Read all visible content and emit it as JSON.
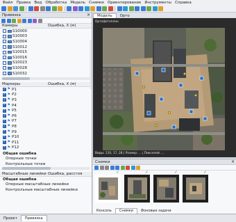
{
  "menubar": {
    "items": [
      "Файл",
      "Правка",
      "Вид",
      "Обработка",
      "Модель",
      "Снимки",
      "Ориентирование",
      "Инструменты",
      "Справка"
    ]
  },
  "toolbar_colors": [
    "#3b7bd4",
    "#e1a02d",
    "#4a90d9",
    "#6aa84f",
    "#3b7bd4",
    "#d34b3b",
    "#888888",
    "#3b7bd4",
    "#6aa84f",
    "#e1a02d",
    "#3b7bd4",
    "#8e5cc7",
    "#3b7bd4",
    "#2d9bd1",
    "#e1a02d",
    "#3b7bd4",
    "#6aa84f",
    "#d34b3b",
    "#3b7bd4",
    "#2d9bd1",
    "#6aa84f",
    "#3b7bd4",
    "#3b7bd4",
    "#6aa84f",
    "#2d9bd1",
    "#e1a02d"
  ],
  "reference_panel": {
    "title": "Привязка",
    "cameras_header": "Камеры",
    "cameras_error_header": "Ошибка, X (м)",
    "cameras": [
      "S10000",
      "S10003",
      "S10004",
      "S10012",
      "S10015",
      "S10016",
      "S10023",
      "S10028",
      "S10032"
    ],
    "markers_header": "Маркеры",
    "markers_error_header": "Ошибка, X (м)",
    "markers": [
      "P1",
      "P2",
      "P3",
      "P4",
      "P5",
      "P6",
      "P7",
      "P8",
      "P9",
      "P10",
      "P11",
      "P12"
    ],
    "total_error_label": "Общая ошибка",
    "control_points_label": "Опорные точки",
    "check_points_label": "Контрольные точки"
  },
  "scalebar_panel": {
    "col1": "Масштабные линейки",
    "col2": "Ошибка, расстоя",
    "total_error_label": "Общая ошибка",
    "control_scalebars_label": "Опорные масштабные линейки",
    "check_scalebars_label": "Контрольные масштабные линейки"
  },
  "bottom_tabs": [
    "Проект",
    "Привязка"
  ],
  "view_tabs": [
    "Модель",
    "Орто"
  ],
  "model_view": {
    "top_label": "Ортофотоплан",
    "bottom_label": "Виды: 110, 17, 28 | Размер: ... | Пикселей: ..."
  },
  "photos_panel": {
    "title": "Снимки",
    "subtabs": [
      "Консоль",
      "Снимки",
      "Фоновые задачи"
    ]
  },
  "colors": {
    "accent": "#2d6cc0",
    "camera_blue": "#5a8fc8",
    "marker_flag": "#1d6fd1",
    "check_green": "#2f9d2f"
  }
}
